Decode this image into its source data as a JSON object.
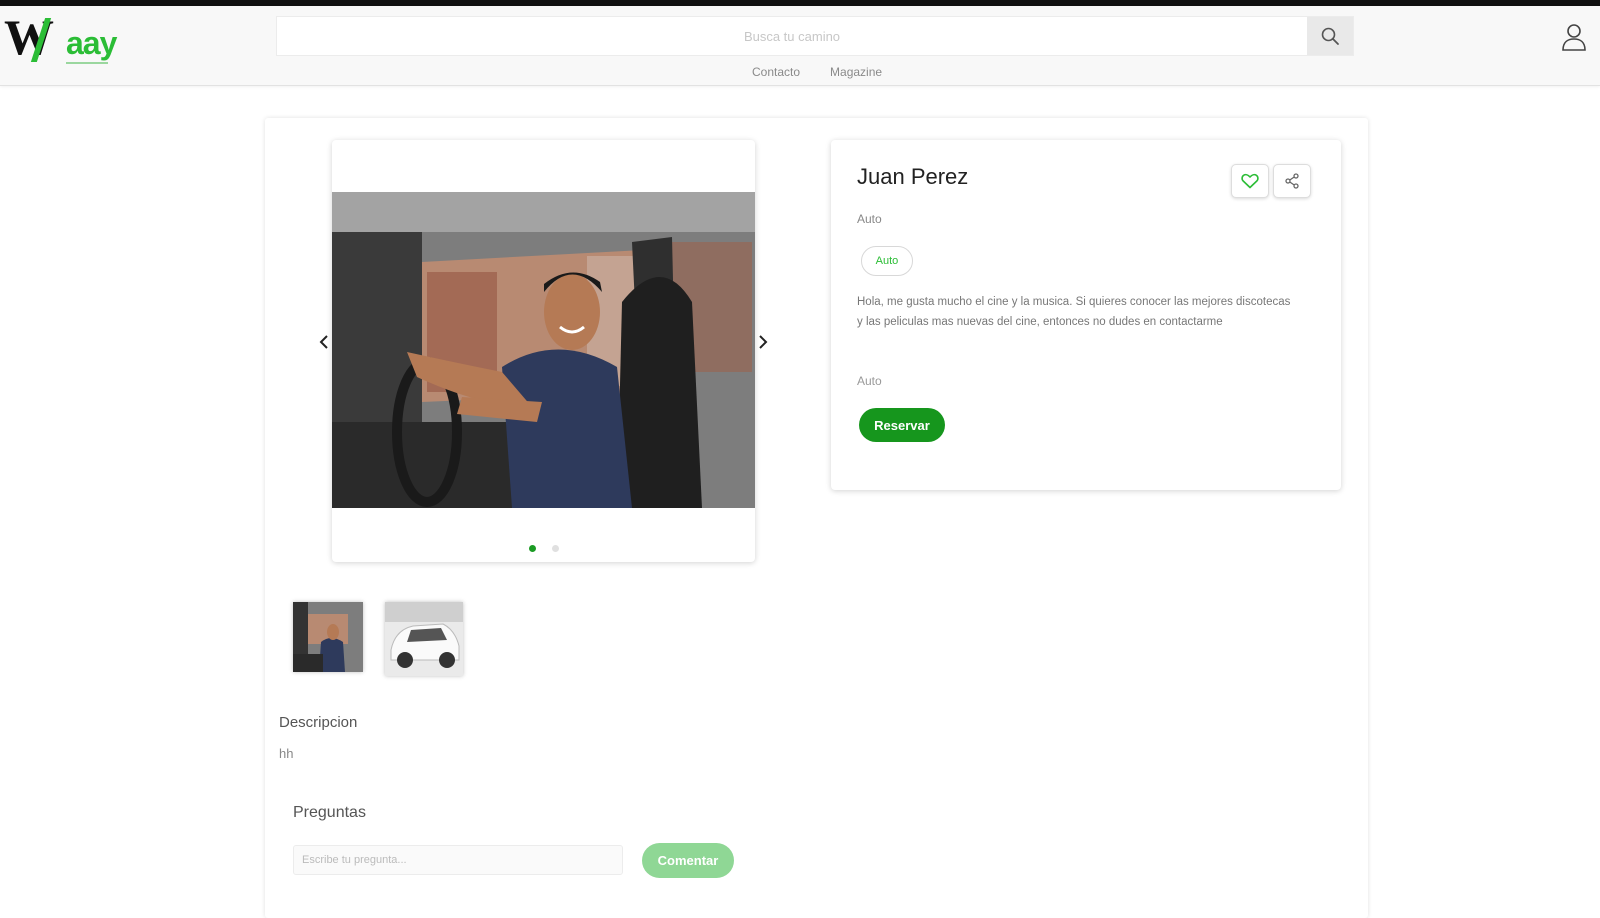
{
  "header": {
    "logo_text": "Waay",
    "search_placeholder": "Busca tu camino",
    "nav": [
      {
        "label": "Contacto"
      },
      {
        "label": "Magazine"
      }
    ]
  },
  "listing": {
    "name": "Juan Perez",
    "subtitle": "Auto",
    "chip": "Auto",
    "bio": "Hola, me gusta mucho el cine y la musica. Si quieres conocer las mejores discotecas y las peliculas mas nuevas del cine, entonces no dudes en contactarme",
    "category": "Auto",
    "reserve_label": "Reservar",
    "carousel": {
      "slides": 2,
      "active": 1
    },
    "thumbnails": 2
  },
  "description": {
    "title": "Descripcion",
    "text": "hh"
  },
  "questions": {
    "title": "Preguntas",
    "placeholder": "Escribe tu pregunta...",
    "button_label": "Comentar"
  },
  "colors": {
    "brand_green": "#16961d",
    "light_green": "#8fd795",
    "logo_green": "#2bbd36"
  }
}
